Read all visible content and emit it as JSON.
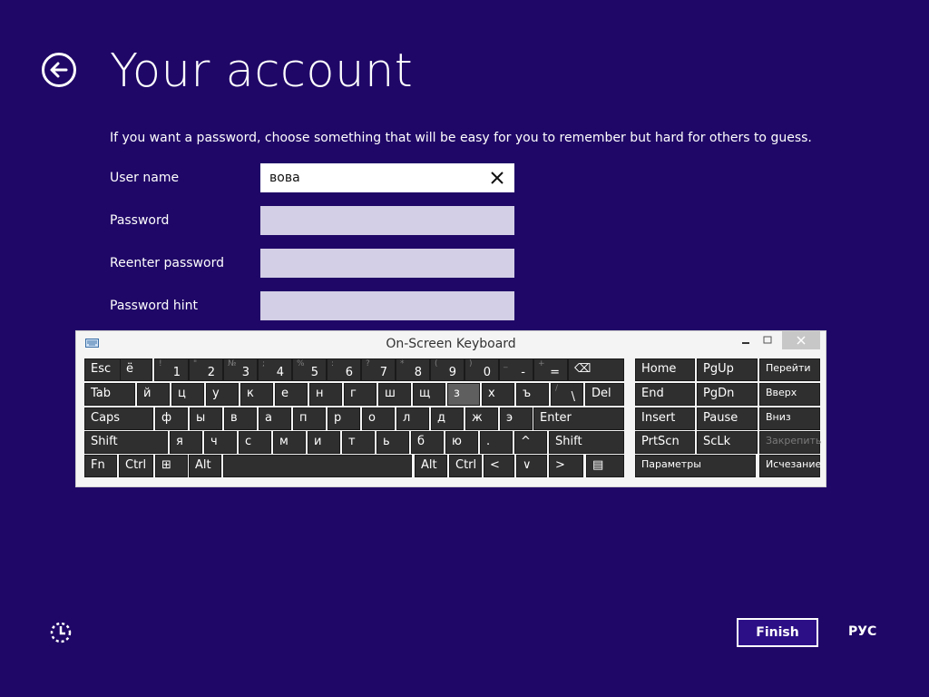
{
  "page": {
    "title": "Your account",
    "intro": "If you want a password, choose something that will be easy for you to remember but hard for others to guess."
  },
  "form": {
    "username_label": "User name",
    "username_value": "вова",
    "password_label": "Password",
    "reenter_label": "Reenter password",
    "hint_label": "Password hint"
  },
  "osk": {
    "title": "On-Screen Keyboard",
    "rows": [
      [
        {
          "main": "Esc"
        },
        {
          "main": "ё"
        },
        {
          "sub": "!",
          "main": "1"
        },
        {
          "sub": "\"",
          "main": "2"
        },
        {
          "sub": "№",
          "main": "3"
        },
        {
          "sub": ";",
          "main": "4"
        },
        {
          "sub": "%",
          "main": "5"
        },
        {
          "sub": ":",
          "main": "6"
        },
        {
          "sub": "?",
          "main": "7"
        },
        {
          "sub": "*",
          "main": "8"
        },
        {
          "sub": "(",
          "main": "9"
        },
        {
          "sub": ")",
          "main": "0"
        },
        {
          "sub": "_",
          "main": "-"
        },
        {
          "sub": "+",
          "main": "="
        },
        {
          "main": "⌫"
        }
      ],
      [
        {
          "main": "Tab"
        },
        {
          "main": "й"
        },
        {
          "main": "ц"
        },
        {
          "main": "у"
        },
        {
          "main": "к"
        },
        {
          "main": "е"
        },
        {
          "main": "н"
        },
        {
          "main": "г"
        },
        {
          "main": "ш"
        },
        {
          "main": "щ"
        },
        {
          "main": "з"
        },
        {
          "main": "х"
        },
        {
          "main": "ъ"
        },
        {
          "sub": "/",
          "main": "\\"
        },
        {
          "main": "Del"
        }
      ],
      [
        {
          "main": "Caps"
        },
        {
          "main": "ф"
        },
        {
          "main": "ы"
        },
        {
          "main": "в"
        },
        {
          "main": "а"
        },
        {
          "main": "п"
        },
        {
          "main": "р"
        },
        {
          "main": "о"
        },
        {
          "main": "л"
        },
        {
          "main": "д"
        },
        {
          "main": "ж"
        },
        {
          "main": "э"
        },
        {
          "main": "Enter"
        }
      ],
      [
        {
          "main": "Shift"
        },
        {
          "main": "я"
        },
        {
          "main": "ч"
        },
        {
          "main": "с"
        },
        {
          "main": "м"
        },
        {
          "main": "и"
        },
        {
          "main": "т"
        },
        {
          "main": "ь"
        },
        {
          "main": "б"
        },
        {
          "main": "ю"
        },
        {
          "main": "."
        },
        {
          "main": "^"
        },
        {
          "main": "Shift"
        }
      ],
      [
        {
          "main": "Fn"
        },
        {
          "main": "Ctrl"
        },
        {
          "main": "⊞"
        },
        {
          "main": "Alt"
        },
        {
          "main": ""
        },
        {
          "main": "Alt"
        },
        {
          "main": "Ctrl"
        },
        {
          "main": "<"
        },
        {
          "main": "∨"
        },
        {
          "main": ">"
        },
        {
          "main": "▤"
        }
      ]
    ],
    "nav_keys": [
      [
        "Home",
        "PgUp",
        "Перейти"
      ],
      [
        "End",
        "PgDn",
        "Вверх"
      ],
      [
        "Insert",
        "Pause",
        "Вниз"
      ],
      [
        "PrtScn",
        "ScLk",
        "Закрепить"
      ],
      [
        "Параметры",
        "Исчезание"
      ]
    ]
  },
  "footer": {
    "finish_label": "Finish",
    "lang_label": "РУС"
  },
  "colors": {
    "background": "#1f0767",
    "key": "#2f2f2f",
    "key_highlight": "#5f5f5f"
  }
}
